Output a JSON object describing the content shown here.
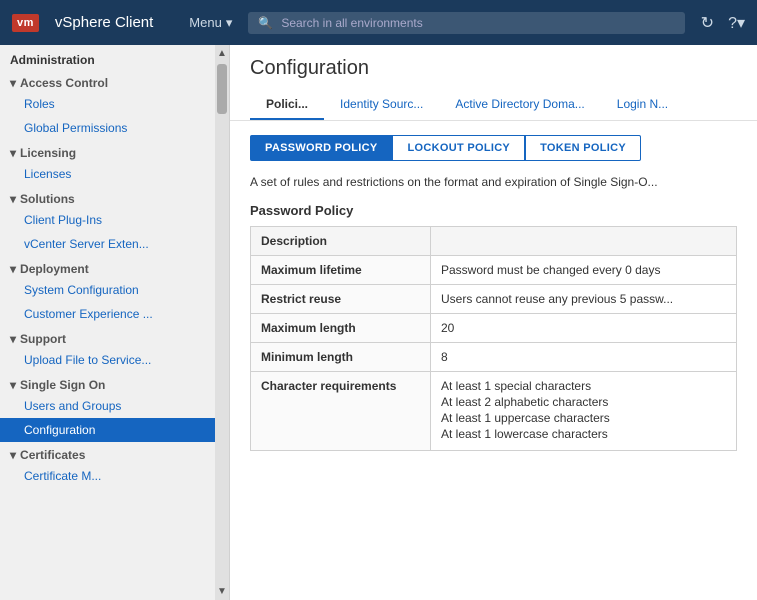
{
  "topnav": {
    "logo": "vm",
    "app_title": "vSphere Client",
    "menu_label": "Menu",
    "search_placeholder": "Search in all environments",
    "refresh_icon": "↻",
    "help_icon": "?"
  },
  "sidebar": {
    "administration_label": "Administration",
    "sections": [
      {
        "key": "access-control",
        "label": "Access Control",
        "expanded": true,
        "items": [
          {
            "key": "roles",
            "label": "Roles",
            "active": false
          },
          {
            "key": "global-permissions",
            "label": "Global Permissions",
            "active": false
          }
        ]
      },
      {
        "key": "licensing",
        "label": "Licensing",
        "expanded": true,
        "items": [
          {
            "key": "licenses",
            "label": "Licenses",
            "active": false
          }
        ]
      },
      {
        "key": "solutions",
        "label": "Solutions",
        "expanded": true,
        "items": [
          {
            "key": "client-plug-ins",
            "label": "Client Plug-Ins",
            "active": false
          },
          {
            "key": "vcenter-server-exten",
            "label": "vCenter Server Exten...",
            "active": false
          }
        ]
      },
      {
        "key": "deployment",
        "label": "Deployment",
        "expanded": true,
        "items": [
          {
            "key": "system-configuration",
            "label": "System Configuration",
            "active": false
          },
          {
            "key": "customer-experience",
            "label": "Customer Experience ...",
            "active": false
          }
        ]
      },
      {
        "key": "support",
        "label": "Support",
        "expanded": true,
        "items": [
          {
            "key": "upload-file",
            "label": "Upload File to Service...",
            "active": false
          }
        ]
      },
      {
        "key": "single-sign-on",
        "label": "Single Sign On",
        "expanded": true,
        "items": [
          {
            "key": "users-and-groups",
            "label": "Users and Groups",
            "active": false
          },
          {
            "key": "configuration",
            "label": "Configuration",
            "active": true
          }
        ]
      },
      {
        "key": "certificates",
        "label": "Certificates",
        "expanded": true,
        "items": [
          {
            "key": "certificate-m",
            "label": "Certificate M...",
            "active": false
          }
        ]
      }
    ]
  },
  "main": {
    "title": "Configuration",
    "tabs": [
      {
        "key": "policies",
        "label": "Polici...",
        "active": true
      },
      {
        "key": "identity-sources",
        "label": "Identity Sourc...",
        "active": false
      },
      {
        "key": "active-directory",
        "label": "Active Directory Doma...",
        "active": false
      },
      {
        "key": "login",
        "label": "Login N...",
        "active": false
      }
    ],
    "policy_buttons": [
      {
        "key": "password-policy",
        "label": "PASSWORD POLICY",
        "active": true
      },
      {
        "key": "lockout-policy",
        "label": "LOCKOUT POLICY",
        "active": false
      },
      {
        "key": "token-policy",
        "label": "TOKEN POLICY",
        "active": false
      }
    ],
    "description": "A set of rules and restrictions on the format and expiration of Single Sign-O...",
    "section_title": "Password Policy",
    "table_header": "Description",
    "table_rows": [
      {
        "label": "Maximum lifetime",
        "value": "Password must be changed every 0 days",
        "multiline": false
      },
      {
        "label": "Restrict reuse",
        "value": "Users cannot reuse any previous 5 passw...",
        "multiline": false
      },
      {
        "label": "Maximum length",
        "value": "20",
        "multiline": false
      },
      {
        "label": "Minimum length",
        "value": "8",
        "multiline": false
      },
      {
        "label": "Character requirements",
        "values": [
          "At least 1 special characters",
          "At least 2 alphabetic characters",
          "At least 1 uppercase characters",
          "At least 1 lowercase characters"
        ],
        "multiline": true
      }
    ]
  }
}
